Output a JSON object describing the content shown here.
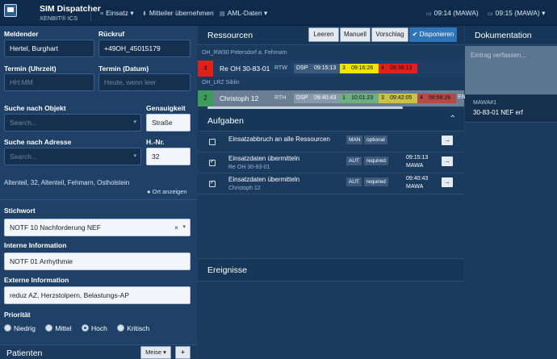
{
  "app": {
    "title": "SIM Dispatcher",
    "subtitle": "XENBIT® ICS"
  },
  "topmenu": {
    "einsatz": "Einsatz",
    "einsatz_caret": "▾",
    "mitteiler": "Mitteiler übernehmen",
    "aml": "AML-Daten",
    "aml_caret": "▾",
    "clock1": "09:14 (MAWA)",
    "clock2": "09:15 (MAWA)",
    "clock_caret": "▾"
  },
  "form": {
    "meldender_label": "Meldender",
    "meldender_value": "Hertel, Burghart",
    "rueckruf_label": "Rückruf",
    "rueckruf_value": "+49OH_45015179",
    "termin_zeit_label": "Termin (Uhrzeit)",
    "termin_zeit_placeholder": "HH:MM",
    "termin_datum_label": "Termin (Datum)",
    "termin_datum_placeholder": "Heute, wenn leer",
    "suche_objekt_label": "Suche nach Objekt",
    "suche_objekt_placeholder": "Search...",
    "genauigkeit_label": "Genauigkeit",
    "genauigkeit_value": "Straße",
    "suche_adresse_label": "Suche nach Adresse",
    "suche_adresse_placeholder": "Search...",
    "hnr_label": "H.-Nr.",
    "hnr_value": "32",
    "address_line": "Altenteil, 32, Altenteil, Fehmarn, Ostholstein",
    "ort_anzeigen": "Ort anzeigen",
    "stichwort_label": "Stichwort",
    "stichwort_value": "NOTF 10 Nachforderung NEF",
    "stichwort_clear": "×",
    "select_caret": "▾",
    "interne_label": "Interne Information",
    "interne_value": "NOTF 01 Arrhythmie",
    "externe_label": "Externe Information",
    "externe_value": "reduz AZ, Herzstolpern, Belastungs-AP",
    "prioritaet_label": "Priorität",
    "prioritaet_options": [
      "Niedrig",
      "Mittel",
      "Hoch",
      "Kritisch"
    ],
    "prioritaet_selected": "Hoch"
  },
  "patienten": {
    "title": "Patienten",
    "meise": "Meise",
    "meise_caret": "▾",
    "add": "+"
  },
  "ressourcen": {
    "title": "Ressourcen",
    "buttons": [
      "Leeren",
      "Manuell",
      "Vorschlag",
      "Disponieren"
    ],
    "active_button": "Disponieren",
    "groups": [
      {
        "label": "OH_RW30 Petersdorf a. Fehmarn",
        "rows": [
          {
            "num": "4",
            "name": "Re OH 30-83-01",
            "type": "RTW",
            "dsp": "DSP",
            "t0": "09:15:13",
            "s1": "3",
            "t1": "09:16:26",
            "s2": "4",
            "t2": "09:38:13"
          }
        ]
      },
      {
        "label": "OH_LRZ Siblin",
        "rows": [
          {
            "num": "2",
            "name": "Christoph 12",
            "type": "RTH",
            "dsp": "DSP",
            "t0": "09:40:43",
            "s1": "1",
            "t1": "10:01:23",
            "s2": "3",
            "t2": "09:42:05",
            "s3": "4",
            "t3": "09:58:26",
            "extra": "EN"
          }
        ]
      }
    ]
  },
  "aufgaben": {
    "title": "Aufgaben",
    "tasks": [
      {
        "checked": false,
        "title": "Einsatzabbruch an alle Ressourcen",
        "sub": "",
        "mode": "MAN",
        "req": "optional",
        "time": "",
        "user": ""
      },
      {
        "checked": true,
        "title": "Einsatzdaten übermitteln",
        "sub": "Re OH 30-83-01",
        "mode": "AUT",
        "req": "required",
        "time": "09:15:13",
        "user": "MAWA"
      },
      {
        "checked": true,
        "title": "Einsatzdaten übermitteln",
        "sub": "Christoph 12",
        "mode": "AUT",
        "req": "required",
        "time": "09:40:43",
        "user": "MAWA"
      }
    ],
    "go_icon": "→"
  },
  "ereignisse": {
    "title": "Ereignisse"
  },
  "dokumentation": {
    "title": "Dokumentation",
    "placeholder": "Eintrag verfassen...",
    "entry_user": "MAWA#1",
    "entry_text": "30-83-01 NEF erf"
  },
  "colors": {
    "red": "#e0201b",
    "yellow": "#f2e600",
    "green": "#3f9b5b",
    "accent": "#2f73b8"
  }
}
